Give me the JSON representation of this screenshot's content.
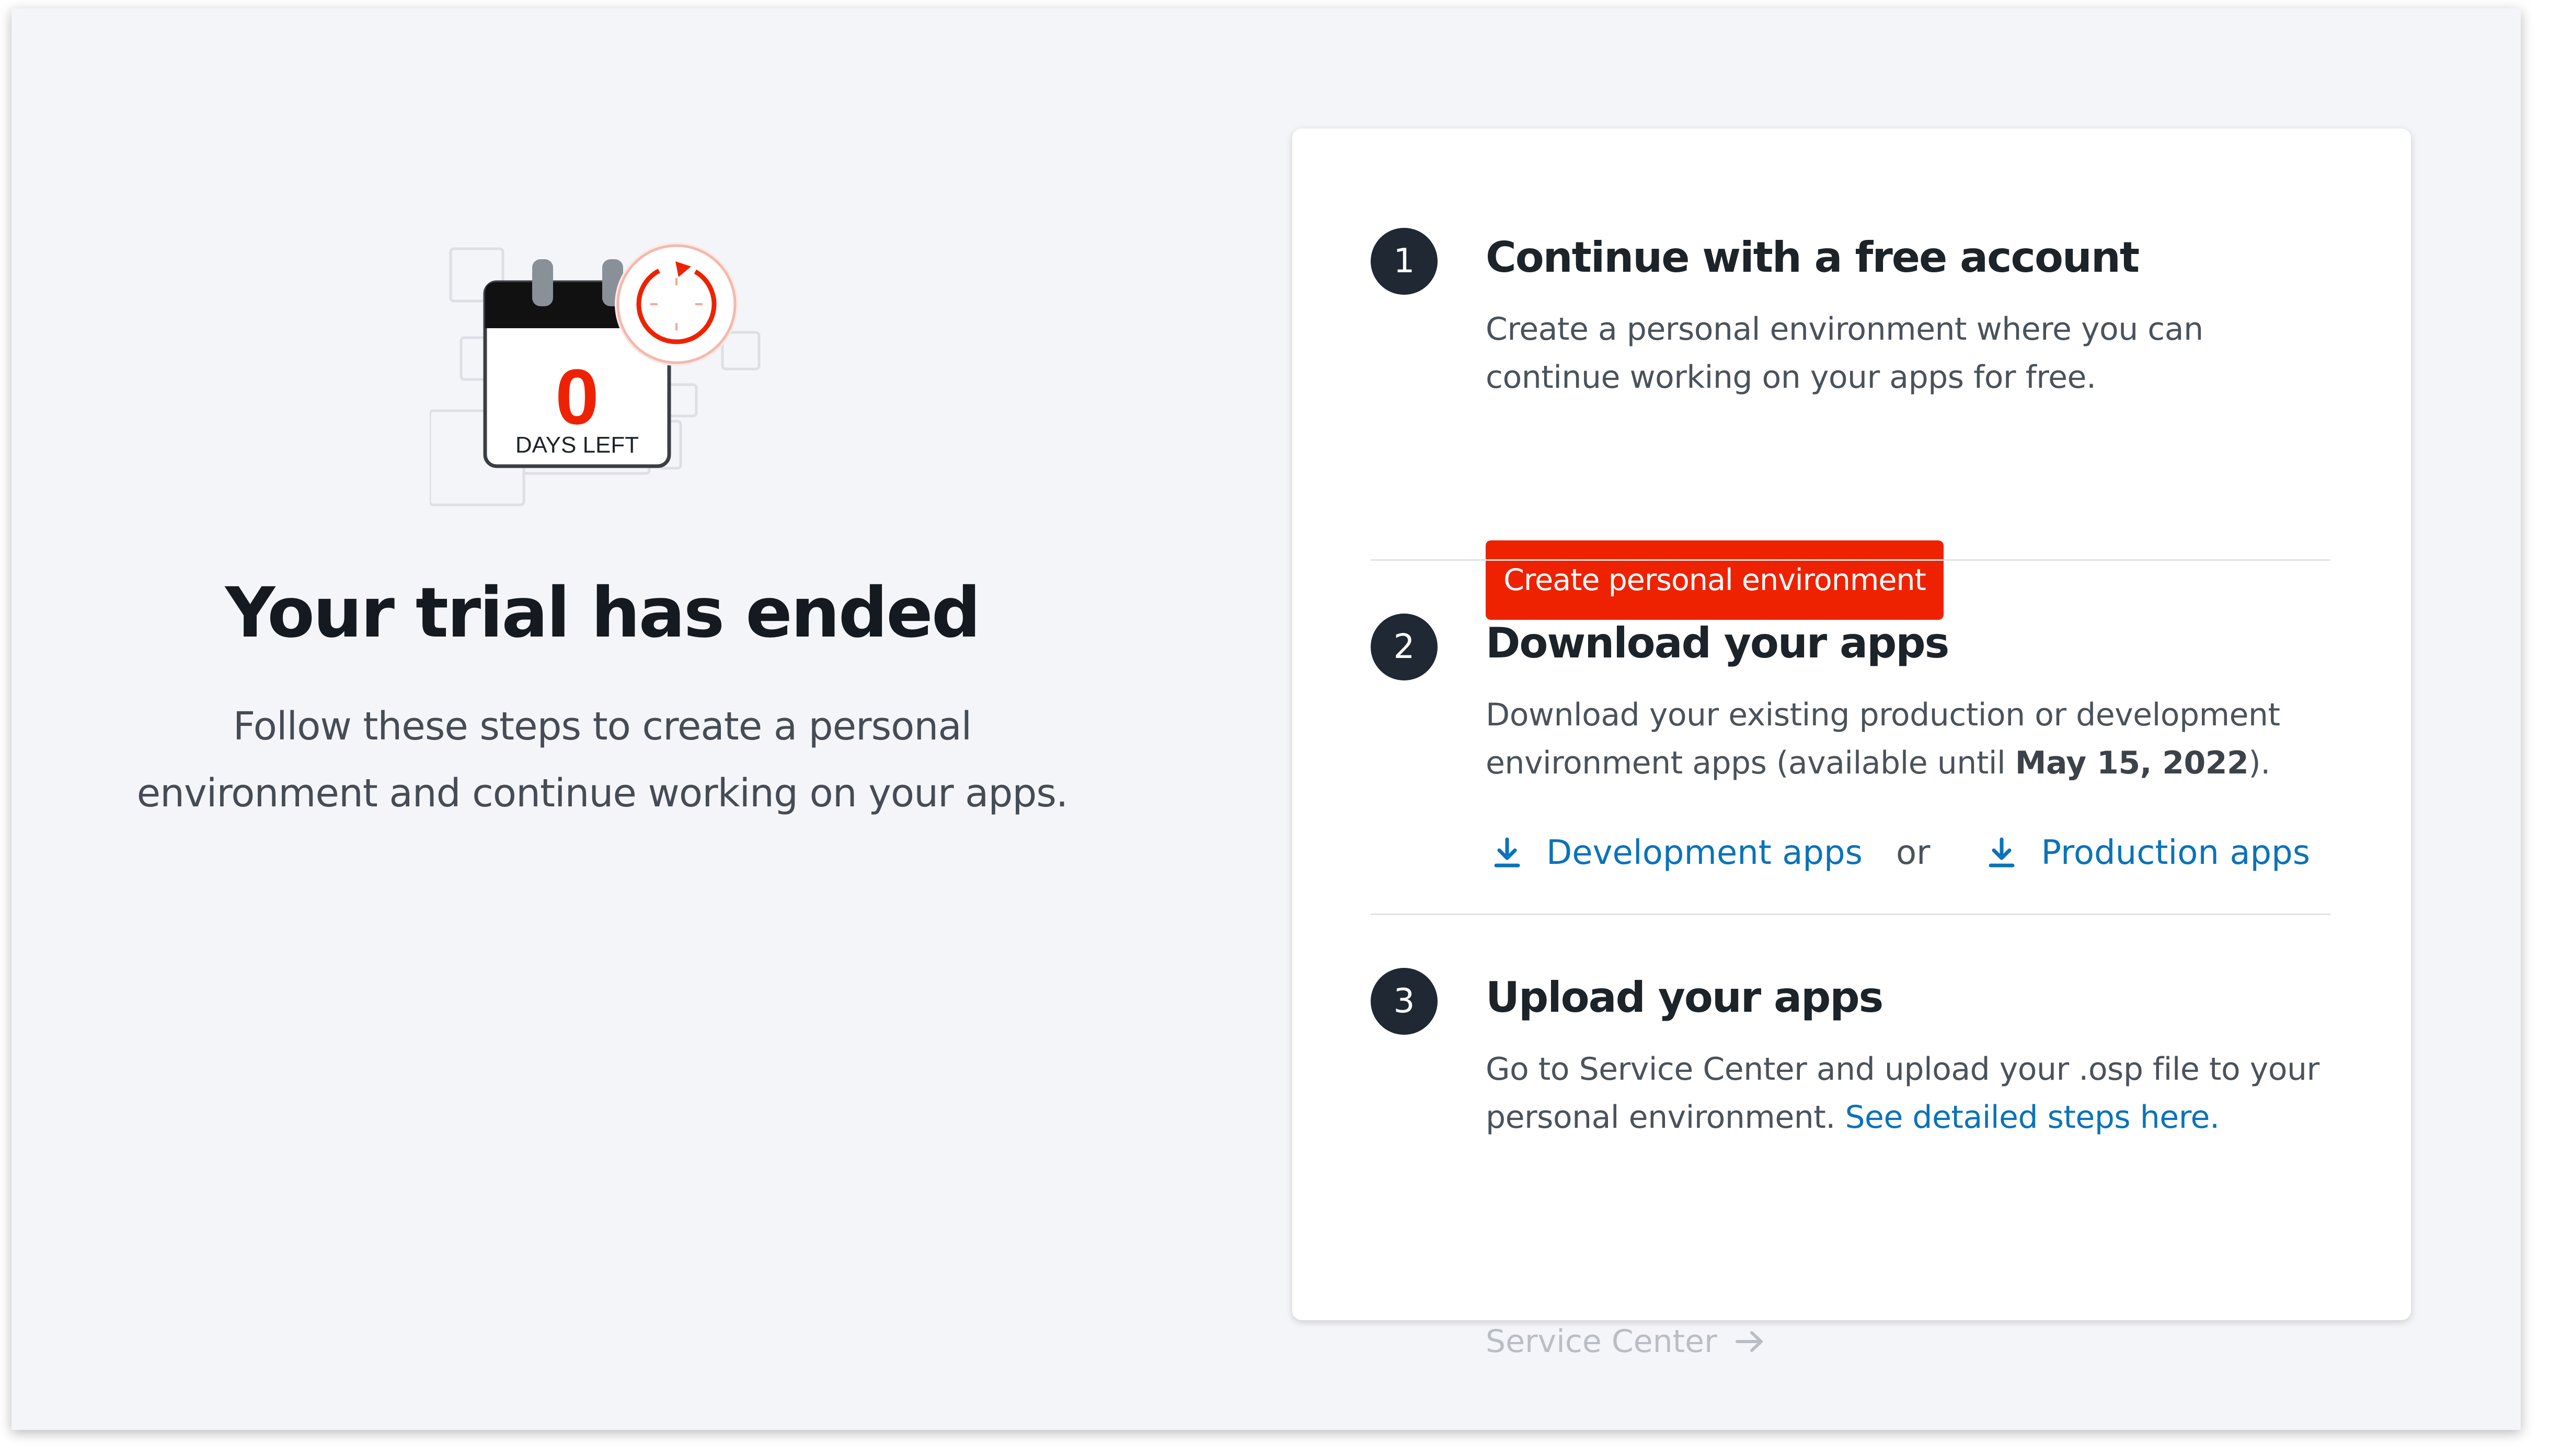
{
  "left": {
    "illustration": {
      "days_number": "0",
      "days_label": "DAYS LEFT"
    },
    "title": "Your trial has ended",
    "subtitle_line1": "Follow these steps to create a personal",
    "subtitle_line2": "environment and continue working on your apps."
  },
  "steps": [
    {
      "number": "1",
      "title": "Continue with a free account",
      "desc_line1": "Create a personal environment where you can",
      "desc_line2": "continue working on your apps for free.",
      "button_label": "Create personal environment"
    },
    {
      "number": "2",
      "title": "Download your apps",
      "desc_line1": "Download your existing production or development",
      "desc_line2_prefix": "environment apps (available until ",
      "desc_line2_date": "May 15, 2022",
      "desc_line2_suffix": ").",
      "dev_link": "Development apps",
      "or_text": "or",
      "prod_link": "Production apps"
    },
    {
      "number": "3",
      "title": "Upload your apps",
      "desc_line1": "Go to Service Center and upload your .osp file to your",
      "desc_line2_prefix": "personal environment. ",
      "desc_line2_link": "See detailed steps here.",
      "service_center_link": "Service Center"
    }
  ],
  "colors": {
    "background": "#f4f5f8",
    "card": "#ffffff",
    "accent_red": "#ee2200",
    "link_blue": "#0a73b9",
    "step_badge": "#1f2833",
    "disabled_gray": "#b9bec4"
  },
  "icons": {
    "calendar": "calendar-icon",
    "timer": "countdown-timer-icon",
    "download": "download-icon",
    "arrow": "arrow-right-icon"
  }
}
